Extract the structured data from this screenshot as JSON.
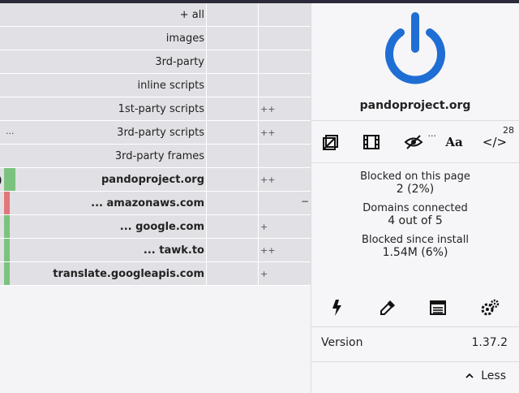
{
  "firewall": {
    "rows": [
      {
        "name": "+ all",
        "local": "",
        "bold": false
      },
      {
        "name": "images",
        "local": "",
        "bold": false
      },
      {
        "name": "3rd-party",
        "local": "",
        "bold": false
      },
      {
        "name": "inline scripts",
        "local": "",
        "bold": false
      },
      {
        "name": "1st-party scripts",
        "local": "++",
        "bold": false
      },
      {
        "name": "3rd-party scripts",
        "local": "++",
        "bold": false,
        "extra": "..."
      },
      {
        "name": "3rd-party frames",
        "local": "",
        "bold": false
      },
      {
        "name": "pandoproject.org",
        "local": "++",
        "bold": true,
        "bar": "green-wide",
        "pointer": ")"
      },
      {
        "name": "... amazonaws.com",
        "local": "",
        "bold": true,
        "bar": "red",
        "minus": "−"
      },
      {
        "name": "... google.com",
        "local": "+",
        "bold": true,
        "bar": "green"
      },
      {
        "name": "... tawk.to",
        "local": "++",
        "bold": true,
        "bar": "green"
      },
      {
        "name": "translate.googleapis.com",
        "local": "+",
        "bold": true,
        "bar": "green"
      }
    ]
  },
  "panel": {
    "hostname": "pandoproject.org",
    "tools": [
      {
        "icon": "no-popups-icon"
      },
      {
        "icon": "media-icon"
      },
      {
        "icon": "cosmetic-filter-icon",
        "extra": "..."
      },
      {
        "icon": "font-icon",
        "text": "Aa"
      },
      {
        "icon": "script-icon",
        "text": "</>",
        "badge": "28"
      }
    ],
    "stats": {
      "blocked_page_label": "Blocked on this page",
      "blocked_page_value": "2 (2%)",
      "domains_label": "Domains connected",
      "domains_value": "4 out of 5",
      "blocked_install_label": "Blocked since install",
      "blocked_install_value": "1.54M (6%)"
    },
    "actions": [
      {
        "icon": "zap-icon"
      },
      {
        "icon": "picker-icon"
      },
      {
        "icon": "logger-icon"
      },
      {
        "icon": "settings-icon"
      }
    ],
    "version_label": "Version",
    "version_value": "1.37.2",
    "less_label": "Less",
    "power_color": "#1f6ed4"
  }
}
